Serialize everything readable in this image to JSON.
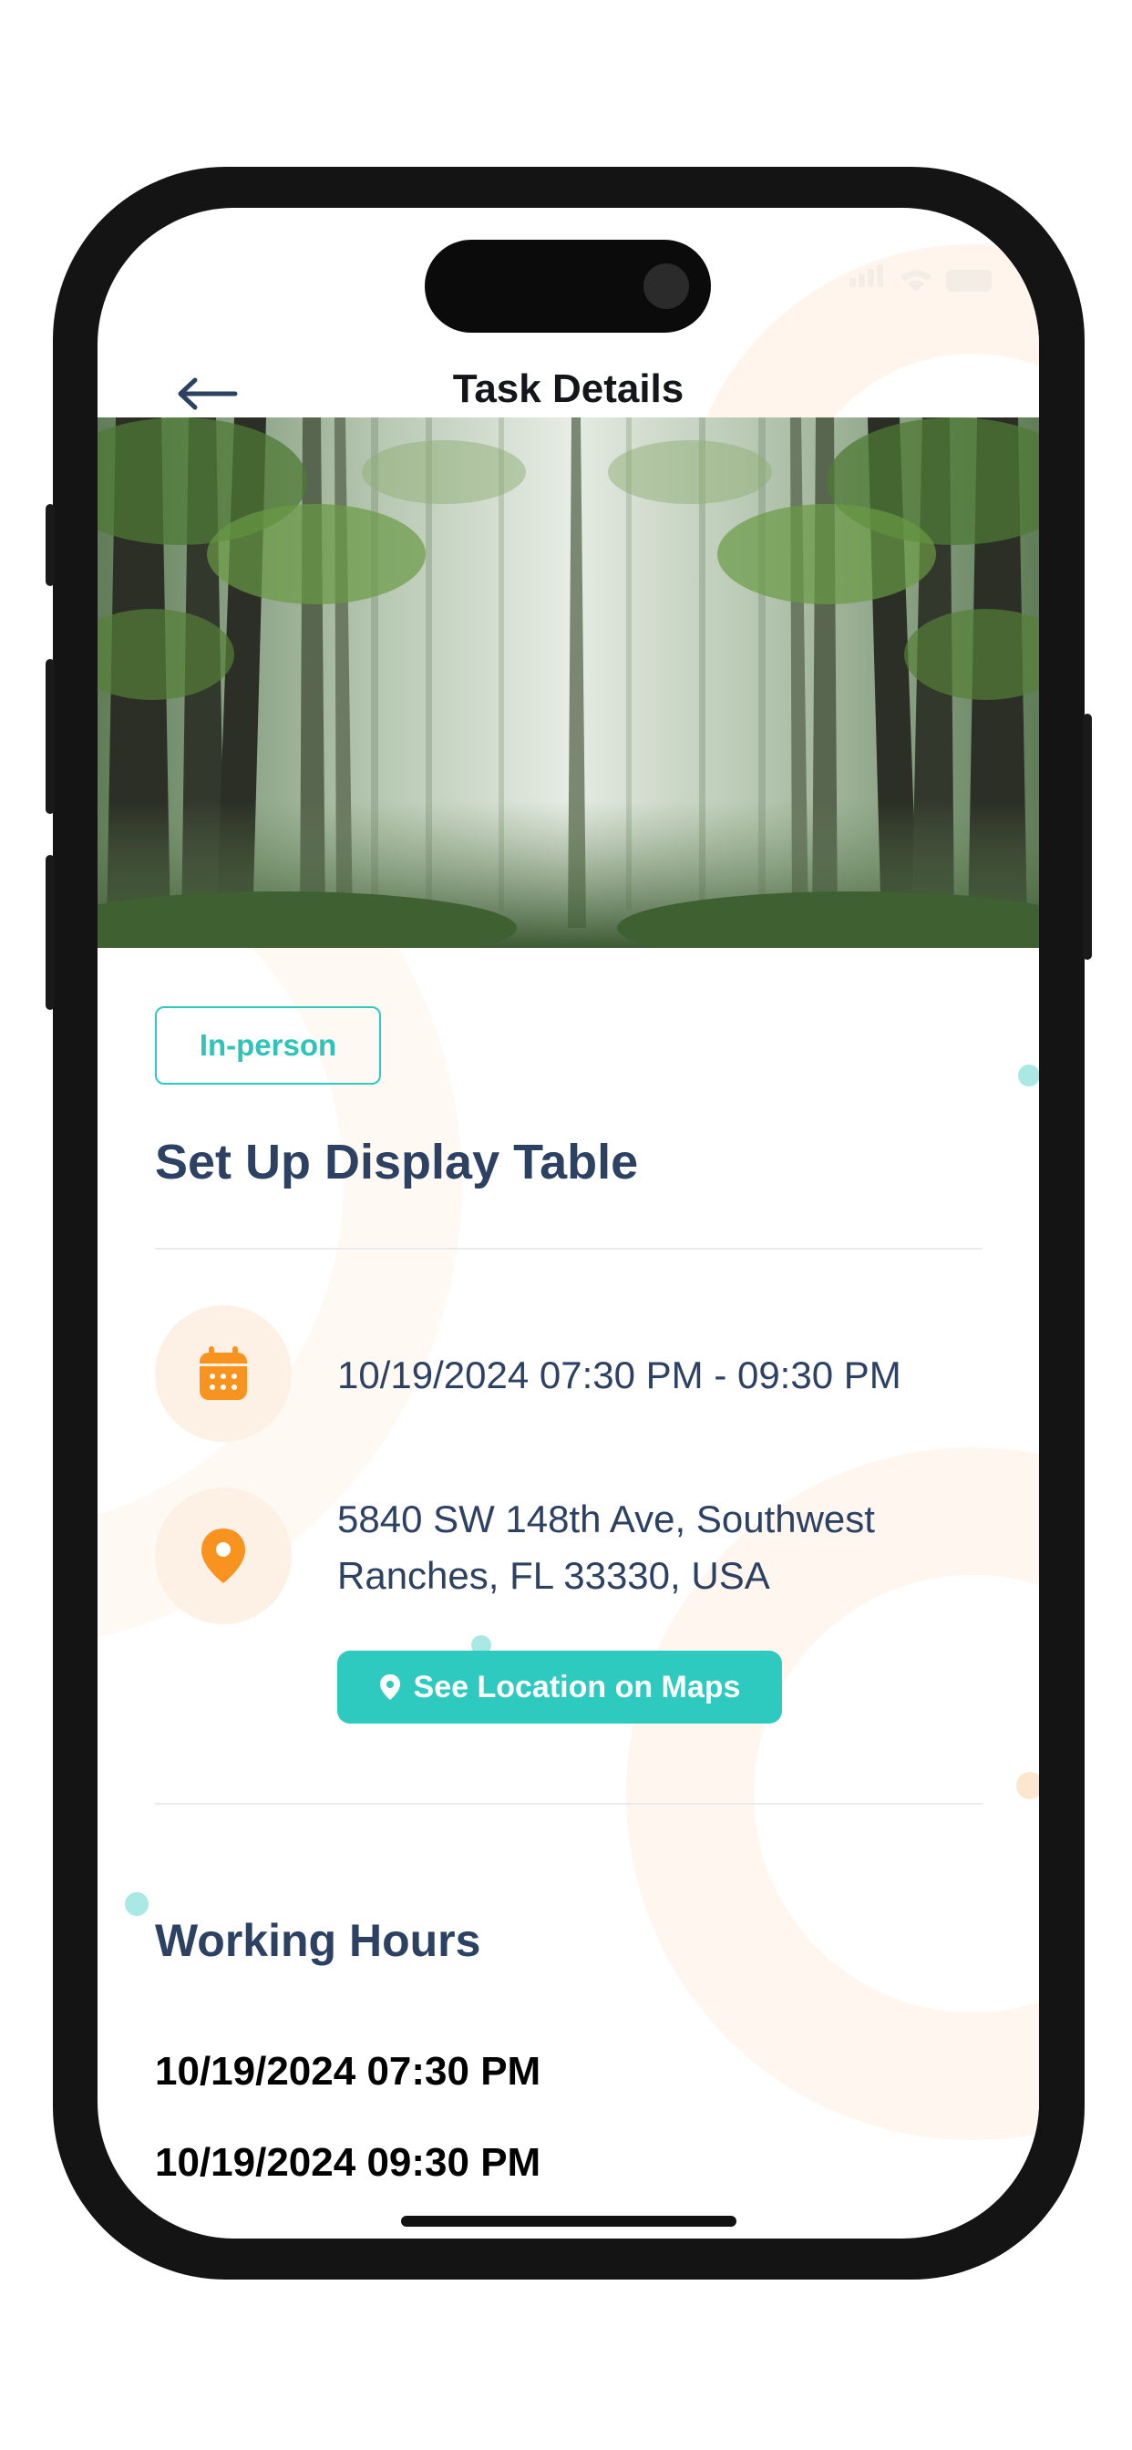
{
  "header": {
    "title": "Task Details",
    "back_icon": "arrow-left-icon"
  },
  "hero_image": {
    "icon": "forest-photo"
  },
  "task": {
    "badge": "In-person",
    "title": "Set Up Display Table",
    "datetime": "10/19/2024 07:30 PM - 09:30 PM",
    "address_line1": "5840 SW 148th Ave, Southwest",
    "address_line2": "Ranches, FL 33330, USA",
    "maps_button_label": "See Location on Maps"
  },
  "working_hours": {
    "title": "Working Hours",
    "start": "10/19/2024 07:30 PM",
    "end": "10/19/2024 09:30 PM"
  },
  "colors": {
    "accent": "#2ecac0",
    "title_text": "#2d4263",
    "icon_orange": "#f7931e",
    "icon_bg": "#fdf1e6"
  },
  "icons": [
    "arrow-left-icon",
    "calendar-icon",
    "location-pin-icon",
    "map-pin-small-icon"
  ]
}
